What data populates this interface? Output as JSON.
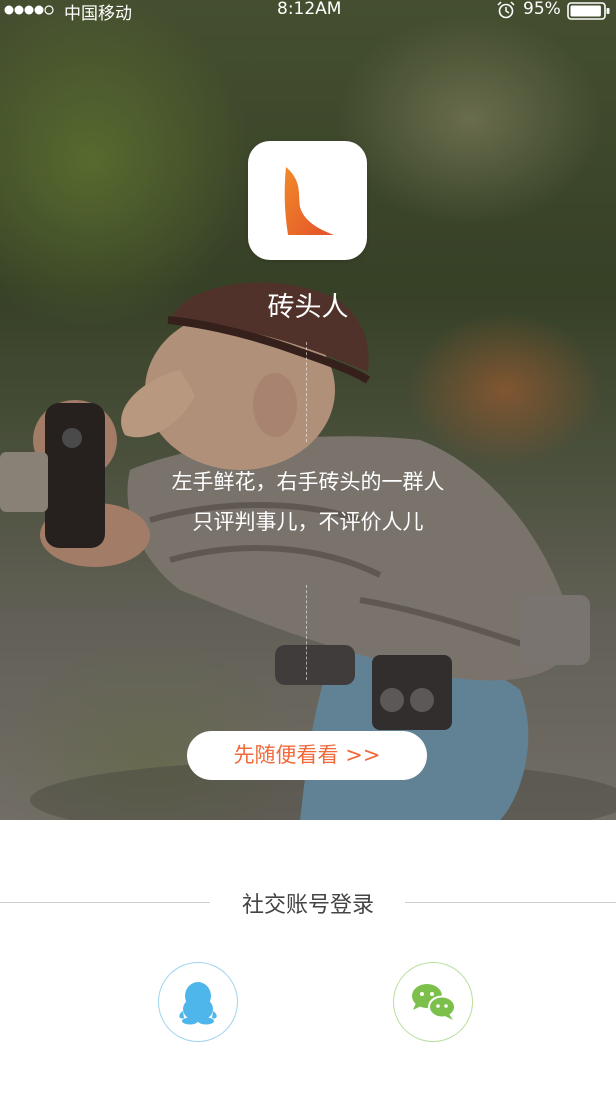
{
  "status_bar": {
    "signal_dots": 5,
    "signal_filled": 4,
    "carrier": "中国移动",
    "time": "8:12AM",
    "battery_percent": "95%",
    "battery_level": 0.95,
    "alarm_icon": "alarm-clock-icon"
  },
  "app": {
    "logo_icon": "leaf-logo-icon",
    "name": "砖头人",
    "tagline_line1": "左手鲜花，右手砖头的一群人",
    "tagline_line2": "只评判事儿，不评价人儿"
  },
  "browse": {
    "label": "先随便看看 >>"
  },
  "social_login": {
    "title": "社交账号登录",
    "qq_icon": "qq-penguin-icon",
    "wechat_icon": "wechat-icon"
  },
  "colors": {
    "accent_orange": "#f06a3b",
    "qq_blue": "#4fb6ec",
    "wechat_green": "#7cc04b",
    "divider_gray": "#cfcfcf"
  }
}
